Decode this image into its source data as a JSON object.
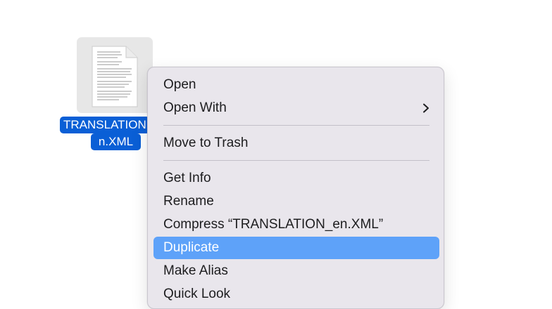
{
  "desktop": {
    "file": {
      "label_line1": "TRANSLATION",
      "label_line2": "n.XML",
      "icon": "text-document-icon"
    }
  },
  "context_menu": {
    "items": [
      {
        "label": "Open"
      },
      {
        "label": "Open With",
        "icon": "chevron-right-icon"
      },
      {
        "label": "Move to Trash"
      },
      {
        "label": "Get Info"
      },
      {
        "label": "Rename"
      },
      {
        "label": "Compress “TRANSLATION_en.XML”"
      },
      {
        "label": "Duplicate",
        "selected": true
      },
      {
        "label": "Make Alias"
      },
      {
        "label": "Quick Look"
      }
    ]
  },
  "colors": {
    "selection_blue": "#0a5fd6",
    "menu_highlight": "#5ea2f9",
    "menu_background": "#e9e6ec"
  }
}
